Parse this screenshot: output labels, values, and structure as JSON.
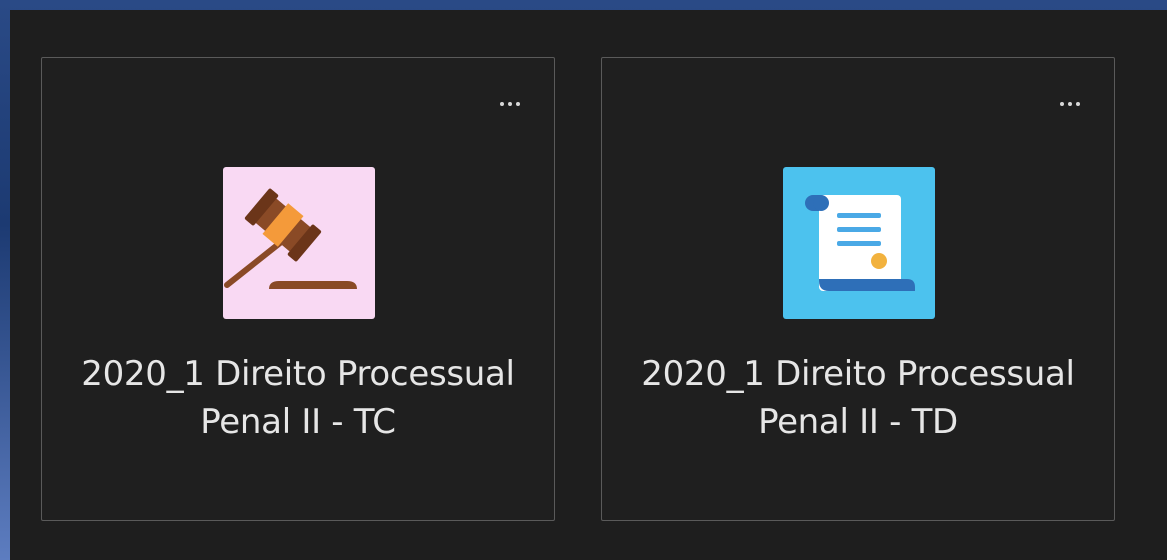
{
  "cards": [
    {
      "line1": "2020_1 Direito Processual",
      "line2": "Penal II - TC",
      "icon": "gavel-icon",
      "tile_color": "#f9d9f3"
    },
    {
      "line1": "2020_1 Direito Processual",
      "line2": "Penal II - TD",
      "icon": "scroll-icon",
      "tile_color": "#4cc2ee"
    }
  ],
  "more_options_label": "More options"
}
